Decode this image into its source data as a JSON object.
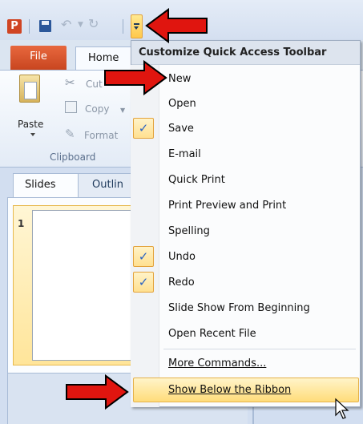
{
  "quick_access": {
    "app_logo_letter": "P",
    "icons": [
      "save-icon",
      "undo-icon",
      "redo-icon",
      "customize-dropdown-icon"
    ]
  },
  "tabs": {
    "file": "File",
    "home": "Home"
  },
  "ribbon": {
    "paste": "Paste",
    "cut": "Cut",
    "copy": "Copy",
    "format": "Format",
    "group_clipboard": "Clipboard"
  },
  "panes": {
    "slides_tab": "Slides",
    "outline_tab": "Outlin",
    "slide_number": "1"
  },
  "menu": {
    "title": "Customize Quick Access Toolbar",
    "items": [
      {
        "label": "New",
        "checked": false
      },
      {
        "label": "Open",
        "checked": false
      },
      {
        "label": "Save",
        "checked": true
      },
      {
        "label": "E-mail",
        "checked": false
      },
      {
        "label": "Quick Print",
        "checked": false
      },
      {
        "label": "Print Preview and Print",
        "checked": false
      },
      {
        "label": "Spelling",
        "checked": false
      },
      {
        "label": "Undo",
        "checked": true
      },
      {
        "label": "Redo",
        "checked": true
      },
      {
        "label": "Slide Show From Beginning",
        "checked": false
      },
      {
        "label": "Open Recent File",
        "checked": false
      }
    ],
    "more_commands": "More Commands...",
    "show_below_ribbon": "Show Below the Ribbon"
  },
  "checkmark": "✓",
  "colors": {
    "file_tab": "#d9552c",
    "highlight": "#ffe59a",
    "arrow_red": "#e0150f"
  }
}
